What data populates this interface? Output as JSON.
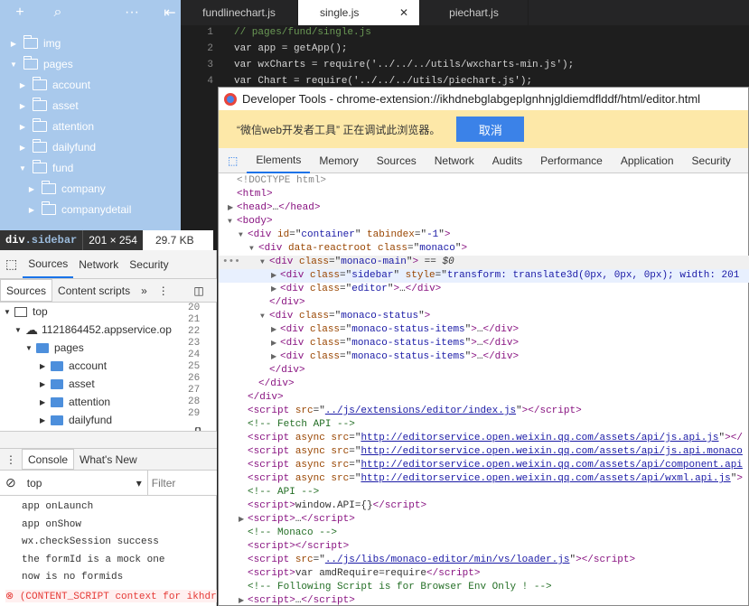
{
  "sidebar": {
    "items": [
      {
        "label": "img",
        "level": 0,
        "open": false
      },
      {
        "label": "pages",
        "level": 0,
        "open": true
      },
      {
        "label": "account",
        "level": 1,
        "open": false
      },
      {
        "label": "asset",
        "level": 1,
        "open": false
      },
      {
        "label": "attention",
        "level": 1,
        "open": false
      },
      {
        "label": "dailyfund",
        "level": 1,
        "open": false
      },
      {
        "label": "fund",
        "level": 1,
        "open": true
      },
      {
        "label": "company",
        "level": 2,
        "open": false
      },
      {
        "label": "companydetail",
        "level": 2,
        "open": false
      }
    ]
  },
  "editor_tabs": [
    "fundlinechart.js",
    "single.js",
    "piechart.js"
  ],
  "code_lines": [
    {
      "n": "1",
      "t": "// pages/fund/single.js"
    },
    {
      "n": "2",
      "t": "var app = getApp();"
    },
    {
      "n": "3",
      "t": "var wxCharts = require('../../../utils/wxcharts-min.js');"
    },
    {
      "n": "4",
      "t": "var Chart = require('../../../utils/piechart.js');"
    }
  ],
  "tooltip": {
    "tag": "div",
    "cls": ".sidebar",
    "dims": "201 × 254",
    "size": "29.7 KB"
  },
  "left_devtools": {
    "tabs": [
      "Sources",
      "Network",
      "Security"
    ],
    "subtabs": [
      "Sources",
      "Content scripts"
    ],
    "tree": [
      {
        "label": "top",
        "level": 0
      },
      {
        "label": "1121864452.appservice.op",
        "level": 1
      },
      {
        "label": "pages",
        "level": 2
      },
      {
        "label": "account",
        "level": 3
      },
      {
        "label": "asset",
        "level": 3
      },
      {
        "label": "attention",
        "level": 3
      },
      {
        "label": "dailyfund",
        "level": 3
      }
    ],
    "gutter": [
      "20",
      "21",
      "22",
      "23",
      "24",
      "25",
      "26",
      "27",
      "28",
      "29"
    ],
    "console_tabs": [
      "Console",
      "What's New"
    ],
    "context": "top",
    "filter_placeholder": "Filter",
    "console_lines": [
      "app onLaunch",
      "app onShow",
      "wx.checkSession success",
      "the formId is a mock one",
      "now is no formids"
    ],
    "error_line": "(CONTENT_SCRIPT context for ikhdr"
  },
  "devtools": {
    "title": "Developer Tools - chrome-extension://ikhdnebglabgeplgnhnjgldiemdflddf/html/editor.html",
    "info_text": "“微信web开发者工具” 正在调试此浏览器。",
    "cancel": "取消",
    "tabs": [
      "Elements",
      "Memory",
      "Sources",
      "Network",
      "Audits",
      "Performance",
      "Application",
      "Security"
    ],
    "dom": [
      {
        "i": 0,
        "h": "<span class='gray'>&lt;!DOCTYPE html&gt;</span>"
      },
      {
        "i": 0,
        "h": "<span class='tg'>&lt;html&gt;</span>"
      },
      {
        "i": 0,
        "a": "▶",
        "h": "<span class='tg'>&lt;head&gt;</span>…<span class='tg'>&lt;/head&gt;</span>"
      },
      {
        "i": 0,
        "a": "▼",
        "h": "<span class='tg'>&lt;body&gt;</span>"
      },
      {
        "i": 1,
        "a": "▼",
        "h": "<span class='tg'>&lt;div </span><span class='an'>id</span>=\"<span class='av'>container</span>\" <span class='an'>tabindex</span>=\"<span class='av'>-1</span>\"<span class='tg'>&gt;</span>"
      },
      {
        "i": 2,
        "a": "▼",
        "h": "<span class='tg'>&lt;div </span><span class='an'>data-reactroot class</span>=\"<span class='av'>monaco</span>\"<span class='tg'>&gt;</span>"
      },
      {
        "i": 3,
        "a": "▼",
        "sel": true,
        "h": "<span class='tg'>&lt;div </span><span class='an'>class</span>=\"<span class='av'>monaco-main</span>\"<span class='tg'>&gt;</span> == <i>$0</i>"
      },
      {
        "i": 4,
        "a": "▶",
        "hl": true,
        "h": "<span class='tg'>&lt;div </span><span class='an'>class</span>=\"<span class='av'>sidebar</span>\" <span class='an'>style</span>=\"<span class='av'>transform: translate3d(0px, 0px, 0px); width: 201</span>"
      },
      {
        "i": 4,
        "a": "▶",
        "h": "<span class='tg'>&lt;div </span><span class='an'>class</span>=\"<span class='av'>editor</span>\"<span class='tg'>&gt;</span>…<span class='tg'>&lt;/div&gt;</span>"
      },
      {
        "i": 3,
        "h": "<span class='tg'>&lt;/div&gt;</span>"
      },
      {
        "i": 3,
        "a": "▼",
        "h": "<span class='tg'>&lt;div </span><span class='an'>class</span>=\"<span class='av'>monaco-status</span>\"<span class='tg'>&gt;</span>"
      },
      {
        "i": 4,
        "a": "▶",
        "h": "<span class='tg'>&lt;div </span><span class='an'>class</span>=\"<span class='av'>monaco-status-items</span>\"<span class='tg'>&gt;</span>…<span class='tg'>&lt;/div&gt;</span>"
      },
      {
        "i": 4,
        "a": "▶",
        "h": "<span class='tg'>&lt;div </span><span class='an'>class</span>=\"<span class='av'>monaco-status-items</span>\"<span class='tg'>&gt;</span>…<span class='tg'>&lt;/div&gt;</span>"
      },
      {
        "i": 4,
        "a": "▶",
        "h": "<span class='tg'>&lt;div </span><span class='an'>class</span>=\"<span class='av'>monaco-status-items</span>\"<span class='tg'>&gt;</span>…<span class='tg'>&lt;/div&gt;</span>"
      },
      {
        "i": 3,
        "h": "<span class='tg'>&lt;/div&gt;</span>"
      },
      {
        "i": 2,
        "h": "<span class='tg'>&lt;/div&gt;</span>"
      },
      {
        "i": 1,
        "h": "<span class='tg'>&lt;/div&gt;</span>"
      },
      {
        "i": 1,
        "h": "<span class='tg'>&lt;script </span><span class='an'>src</span>=\"<span class='lk'>../js/extensions/editor/index.js</span>\"<span class='tg'>&gt;&lt;/script&gt;</span>"
      },
      {
        "i": 1,
        "h": "<span class='cm'>&lt;!-- Fetch API --&gt;</span>"
      },
      {
        "i": 1,
        "h": "<span class='tg'>&lt;script </span><span class='an'>async src</span>=\"<span class='lk'>http://editorservice.open.weixin.qq.com/assets/api/js.api.js</span>\"<span class='tg'>&gt;&lt;/</span>"
      },
      {
        "i": 1,
        "h": "<span class='tg'>&lt;script </span><span class='an'>async src</span>=\"<span class='lk'>http://editorservice.open.weixin.qq.com/assets/api/js.api.monaco</span>"
      },
      {
        "i": 1,
        "h": "<span class='tg'>&lt;script </span><span class='an'>async src</span>=\"<span class='lk'>http://editorservice.open.weixin.qq.com/assets/api/component.api</span>"
      },
      {
        "i": 1,
        "h": "<span class='tg'>&lt;script </span><span class='an'>async src</span>=\"<span class='lk'>http://editorservice.open.weixin.qq.com/assets/api/wxml.api.js</span>\"<span class='tg'>&gt;</span>"
      },
      {
        "i": 1,
        "h": "<span class='cm'>&lt;!-- API --&gt;</span>"
      },
      {
        "i": 1,
        "h": "<span class='tg'>&lt;script&gt;</span>window.API={}<span class='tg'>&lt;/script&gt;</span>"
      },
      {
        "i": 1,
        "a": "▶",
        "h": "<span class='tg'>&lt;script&gt;</span>…<span class='tg'>&lt;/script&gt;</span>"
      },
      {
        "i": 1,
        "h": "<span class='cm'>&lt;!-- Monaco --&gt;</span>"
      },
      {
        "i": 1,
        "h": "<span class='tg'>&lt;script&gt;&lt;/script&gt;</span>"
      },
      {
        "i": 1,
        "h": "<span class='tg'>&lt;script </span><span class='an'>src</span>=\"<span class='lk'>../js/libs/monaco-editor/min/vs/loader.js</span>\"<span class='tg'>&gt;&lt;/script&gt;</span>"
      },
      {
        "i": 1,
        "h": "<span class='tg'>&lt;script&gt;</span>var amdRequire=require<span class='tg'>&lt;/script&gt;</span>"
      },
      {
        "i": 1,
        "h": "<span class='cm'>&lt;!-- Following Script is for Browser Env Only ! --&gt;</span>"
      },
      {
        "i": 1,
        "a": "▶",
        "h": "<span class='tg'>&lt;script&gt;</span>…<span class='tg'>&lt;/script&gt;</span>"
      }
    ]
  }
}
